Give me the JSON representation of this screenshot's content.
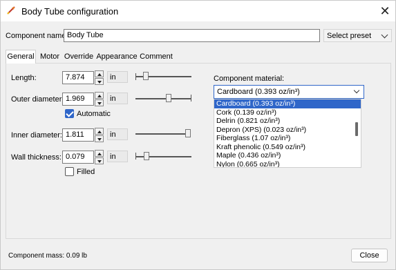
{
  "window": {
    "title": "Body Tube configuration",
    "app_icon": "rocket-icon",
    "close_icon": "close-icon"
  },
  "component_name": {
    "label": "Component name:",
    "value": "Body Tube"
  },
  "preset": {
    "label": "Select preset"
  },
  "tabs": [
    {
      "label": "General",
      "active": true
    },
    {
      "label": "Motor"
    },
    {
      "label": "Override"
    },
    {
      "label": "Appearance"
    },
    {
      "label": "Comment"
    }
  ],
  "fields": {
    "length": {
      "label": "Length:",
      "value": "7.874",
      "unit": "in"
    },
    "outer_diameter": {
      "label": "Outer diameter:",
      "value": "1.969",
      "unit": "in"
    },
    "automatic": {
      "label": "Automatic",
      "checked": true
    },
    "inner_diameter": {
      "label": "Inner diameter:",
      "value": "1.811",
      "unit": "in"
    },
    "wall_thickness": {
      "label": "Wall thickness:",
      "value": "0.079",
      "unit": "in"
    },
    "filled": {
      "label": "Filled",
      "checked": false
    }
  },
  "material": {
    "label": "Component material:",
    "selected": "Cardboard (0.393 oz/in³)",
    "options": [
      "Cardboard (0.393 oz/in³)",
      "Cork (0.139 oz/in³)",
      "Delrin (0.821 oz/in³)",
      "Depron (XPS) (0.023 oz/in³)",
      "Fiberglass (1.07 oz/in³)",
      "Kraft phenolic (0.549 oz/in³)",
      "Maple (0.436 oz/in³)",
      "Nylon (0.665 oz/in³)"
    ]
  },
  "footer": {
    "mass": "Component mass: 0.09 lb",
    "close_label": "Close"
  },
  "colors": {
    "accent": "#2f66c9",
    "background": "#f0f0f0"
  }
}
